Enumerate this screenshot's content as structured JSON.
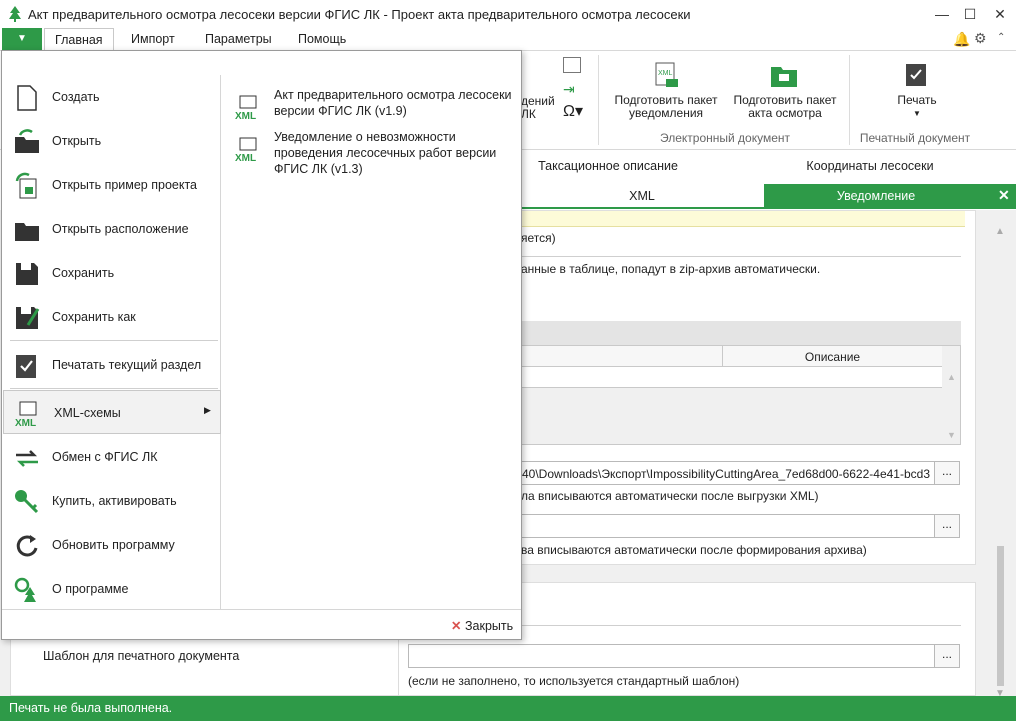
{
  "window": {
    "title": "Акт предварительного осмотра лесосеки версии ФГИС ЛК - Проект акта предварительного осмотра лесосеки"
  },
  "menu": {
    "tabs": [
      "Главная",
      "Импорт",
      "Параметры",
      "Помощь"
    ]
  },
  "ribbon": {
    "partial_label_1": "дений",
    "partial_label_2": "ЛК",
    "prepare_notice": "Подготовить пакет уведомления",
    "prepare_act": "Подготовить пакет акта осмотра",
    "print": "Печать",
    "group_electronic": "Электронный документ",
    "group_print": "Печатный документ"
  },
  "tabs_row1": [
    "Таксационное описание",
    "Координаты лесосеки"
  ],
  "tabs_row2": [
    "XML",
    "Уведомление"
  ],
  "content": {
    "notice_partial": "яется)",
    "zip_note": "анные в таблице, попадут в zip-архив автоматически.",
    "table_header_desc": "Описание",
    "xml_path": "40\\Downloads\\Экспорт\\ImpossibilityCuttingArea_7ed68d00-6622-4e41-bcd3",
    "xml_hint": "ла вписываются автоматически после выгрузки XML)",
    "archive_hint": "ва вписываются автоматически после формирования архива)",
    "template_label": "Шаблон для печатного документа",
    "template_hint": "(если не заполнено, то используется стандартный шаблон)",
    "dots": "..."
  },
  "file_menu": {
    "items": [
      {
        "label": "Создать",
        "icon": "new-document-icon"
      },
      {
        "label": "Открыть",
        "icon": "open-folder-icon"
      },
      {
        "label": "Открыть пример проекта",
        "icon": "open-example-icon"
      },
      {
        "label": "Открыть расположение",
        "icon": "folder-icon"
      },
      {
        "label": "Сохранить",
        "icon": "save-icon"
      },
      {
        "label": "Сохранить как",
        "icon": "save-as-icon"
      },
      {
        "label": "Печатать текущий раздел",
        "icon": "print-section-icon"
      },
      {
        "label": "XML-схемы",
        "icon": "xml-icon"
      },
      {
        "label": "Обмен с ФГИС ЛК",
        "icon": "exchange-icon"
      },
      {
        "label": "Купить, активировать",
        "icon": "key-icon"
      },
      {
        "label": "Обновить программу",
        "icon": "refresh-icon"
      },
      {
        "label": "О программе",
        "icon": "about-icon"
      }
    ],
    "submenu": [
      {
        "label": "Акт предварительного осмотра лесосеки версии ФГИС ЛК (v1.9)"
      },
      {
        "label": "Уведомление о невозможности проведения лесосечных работ версии ФГИС ЛК (v1.3)"
      }
    ],
    "close": "Закрыть"
  },
  "status": {
    "text": "Печать не была выполнена."
  },
  "colors": {
    "accent": "#2e9a48"
  }
}
